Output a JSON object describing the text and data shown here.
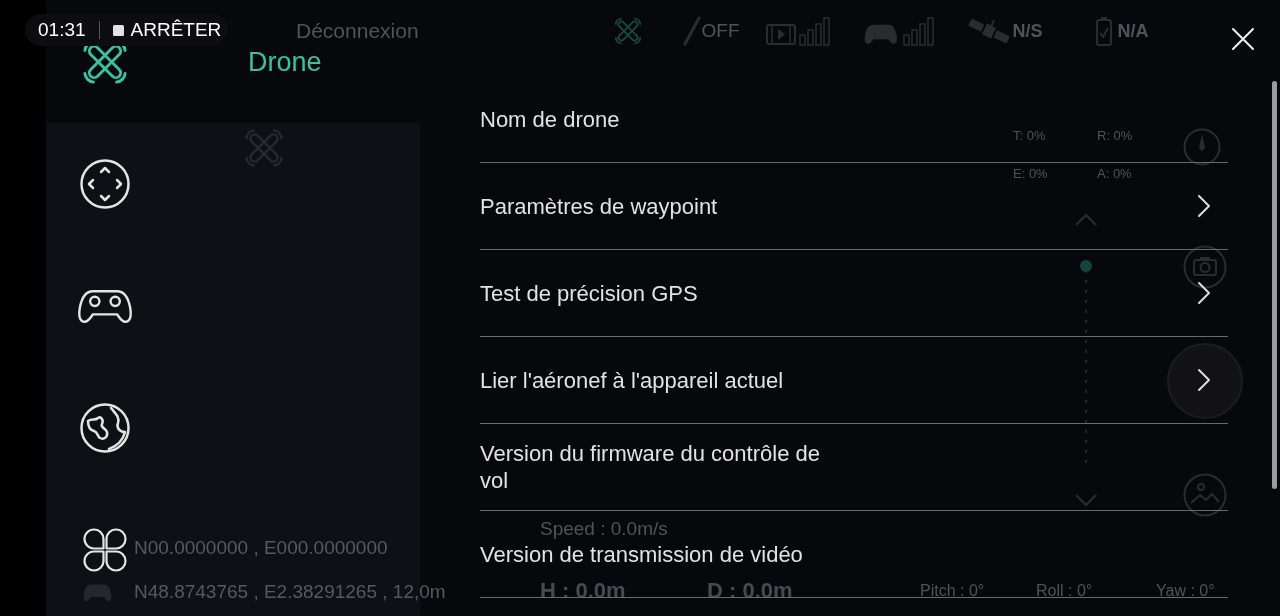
{
  "recording_indicator": {
    "time": "01:31",
    "action": "ARRÊTER"
  },
  "drone_app": {
    "top_bar": {
      "connection": "Déconnexion",
      "motor_status": "OFF",
      "gps_status": "N/S",
      "battery_status": "N/A"
    },
    "map_panel": {
      "coordinates": [
        {
          "kind": "aircraft",
          "text": "N00.0000000 , E000.0000000"
        },
        {
          "kind": "controller",
          "text": "N48.8743765 , E2.38291265 , 12,0m"
        }
      ]
    },
    "attitude": [
      "T: 0%",
      "R: 0%",
      "E: 0%",
      "A: 0%"
    ],
    "camera_slider": {
      "level": 1
    },
    "speed": "Speed : 0.0m/s",
    "telemetry": [
      {
        "kind": "large",
        "text": "H : 0.0m"
      },
      {
        "kind": "large",
        "text": "D : 0.0m"
      },
      {
        "kind": "small",
        "text": "Pitch : 0°"
      },
      {
        "kind": "small",
        "text": "Roll : 0°"
      },
      {
        "kind": "small",
        "text": "Yaw : 0°"
      }
    ]
  },
  "settings_panel": {
    "title": "Drone",
    "sidebar": {
      "items": [
        {
          "kind": "drone",
          "selected": true
        },
        {
          "kind": "dpad",
          "selected": false
        },
        {
          "kind": "gamepad",
          "selected": false
        },
        {
          "kind": "globe",
          "selected": false
        },
        {
          "kind": "quad",
          "selected": false
        }
      ]
    },
    "items": [
      {
        "label": "Nom de drone",
        "chevron": false
      },
      {
        "label": "Paramètres de waypoint",
        "chevron": true
      },
      {
        "label": "Test de précision GPS",
        "chevron": true
      },
      {
        "label": "Lier l'aéronef à l'appareil actuel",
        "chevron": true
      },
      {
        "label": "Version du firmware du contrôle de vol",
        "chevron": false
      },
      {
        "label": "Version de transmission de vidéo",
        "chevron": false
      }
    ]
  }
}
